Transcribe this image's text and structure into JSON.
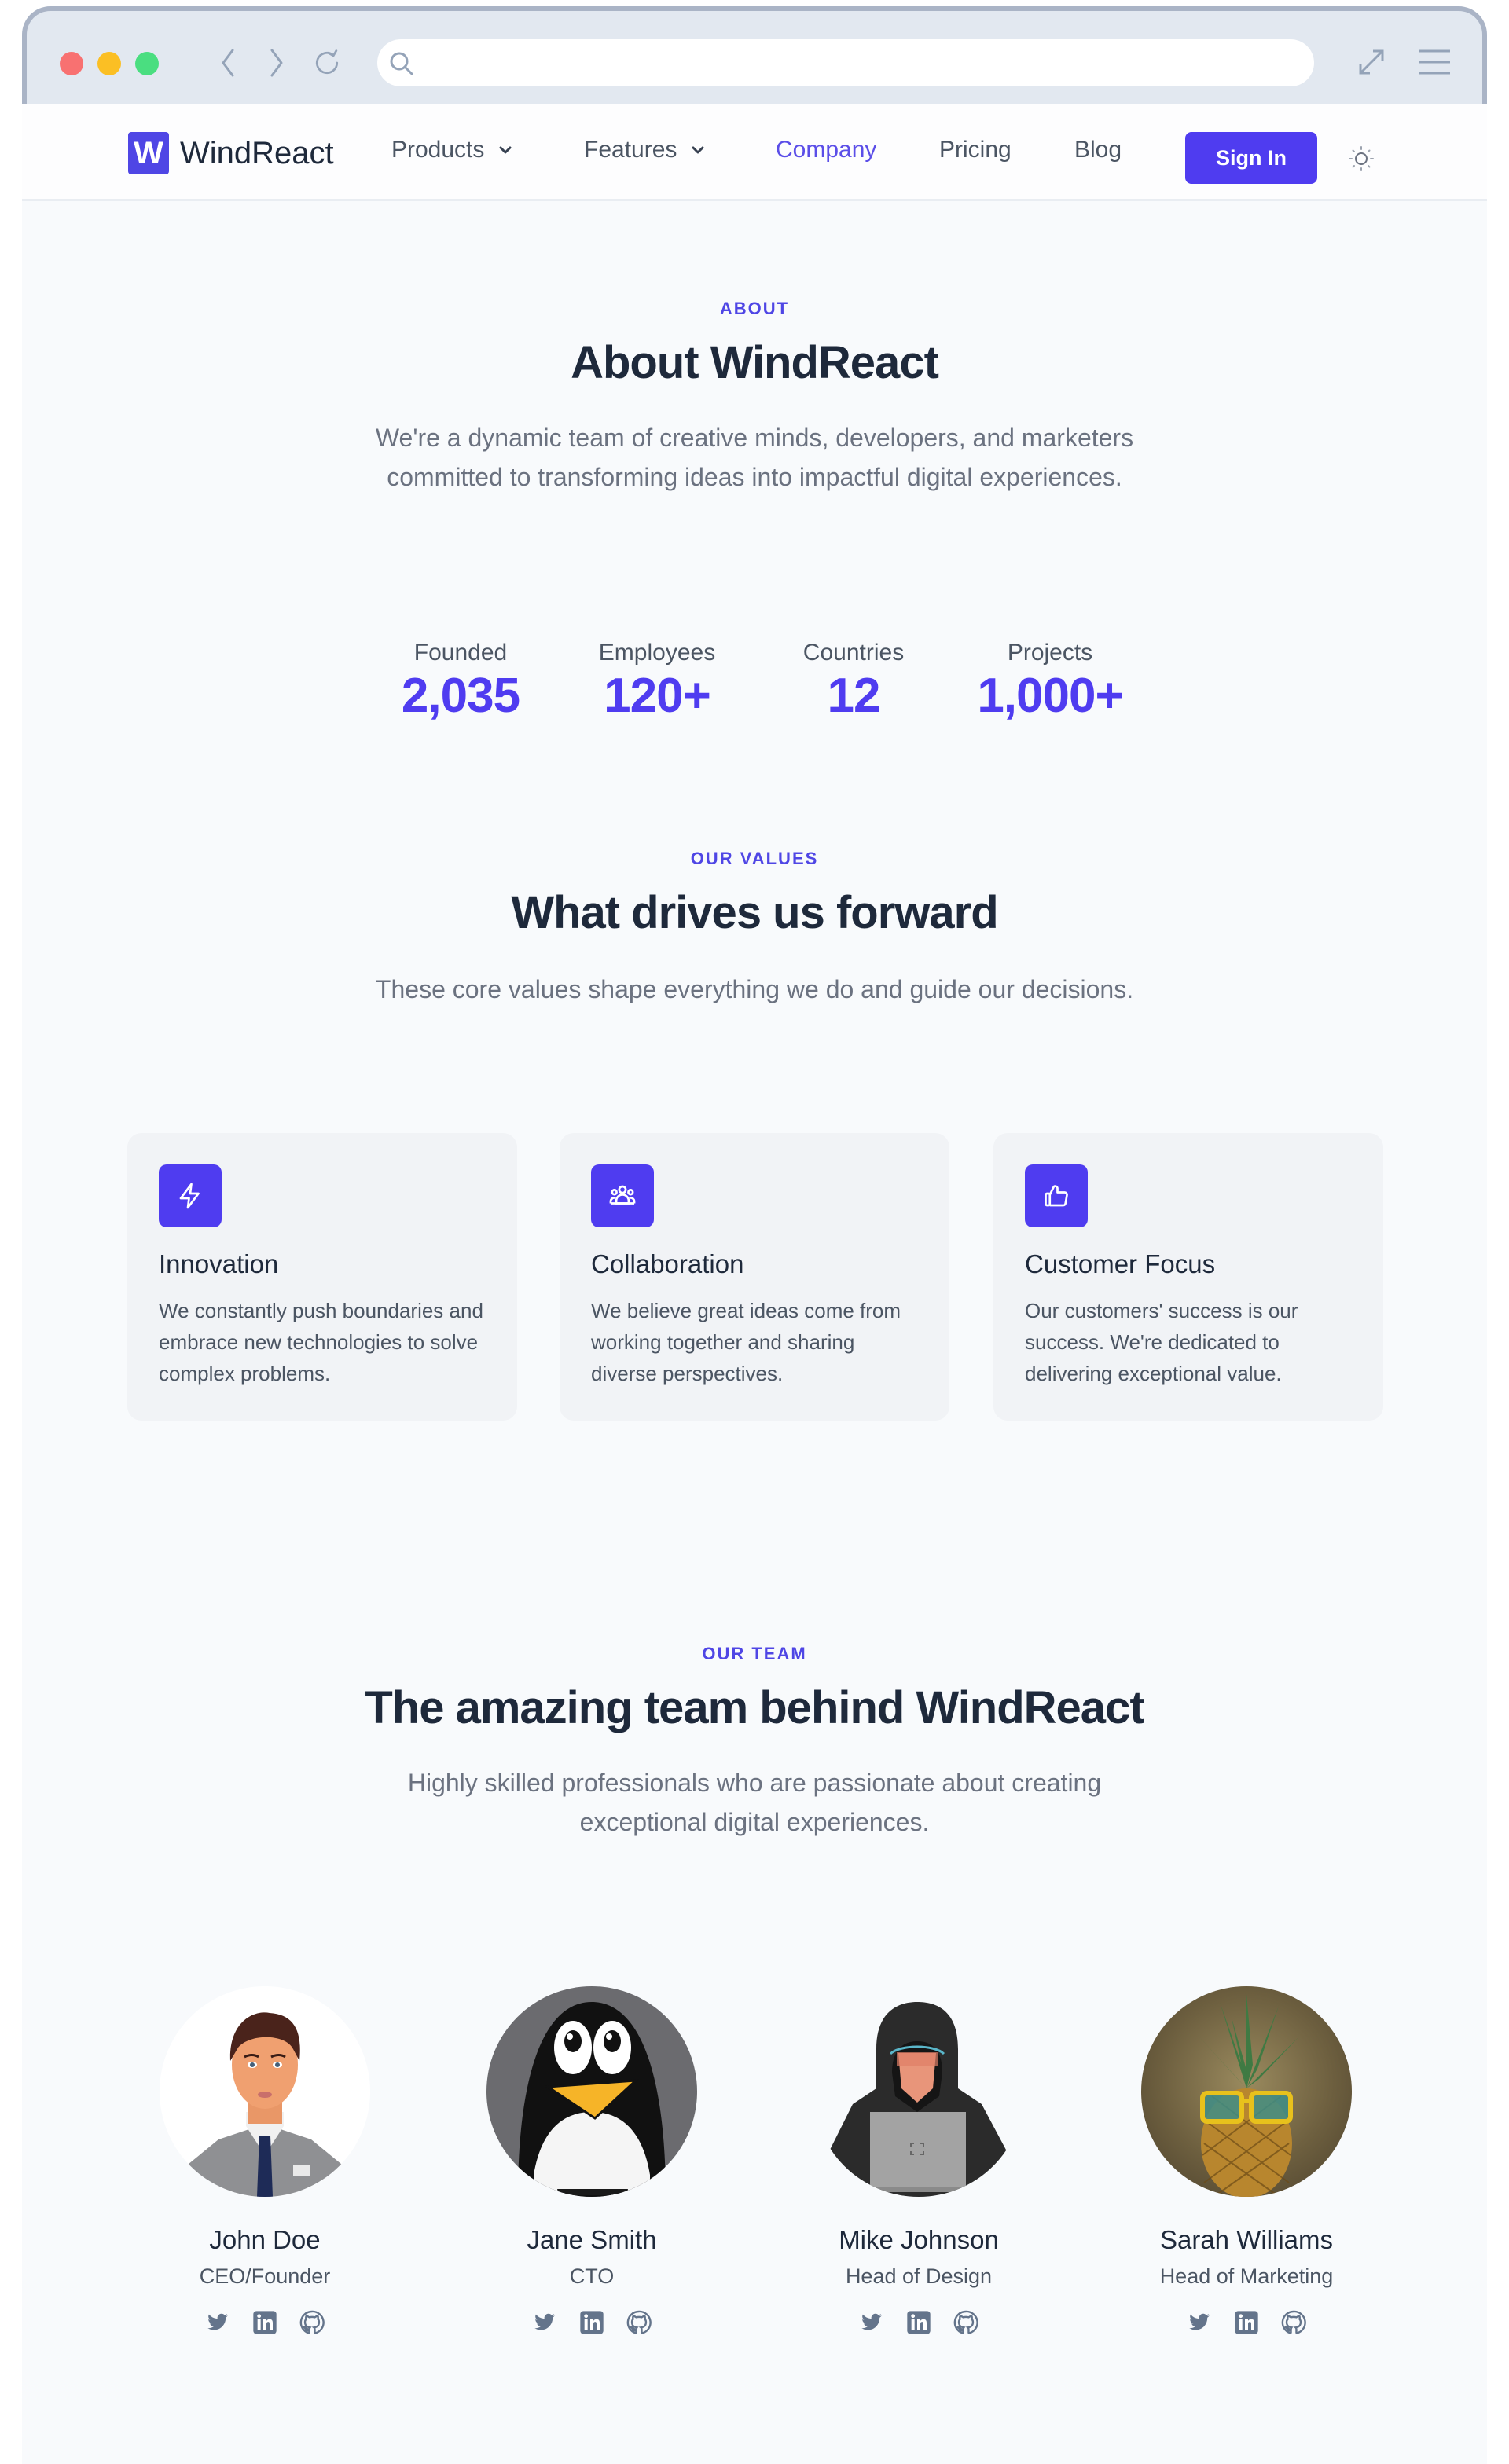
{
  "browser": {
    "url_value": "",
    "url_placeholder": ""
  },
  "nav": {
    "logo_mark": "W",
    "logo_text": "WindReact",
    "links": [
      {
        "label": "Products",
        "has_dropdown": true,
        "active": false
      },
      {
        "label": "Features",
        "has_dropdown": true,
        "active": false
      },
      {
        "label": "Company",
        "has_dropdown": false,
        "active": true
      },
      {
        "label": "Pricing",
        "has_dropdown": false,
        "active": false
      },
      {
        "label": "Blog",
        "has_dropdown": false,
        "active": false
      }
    ],
    "signin_label": "Sign In",
    "theme_icon": "sun-icon"
  },
  "about": {
    "eyebrow": "ABOUT",
    "title": "About WindReact",
    "description": "We're a dynamic team of creative minds, developers, and marketers committed to transforming ideas into impactful digital experiences."
  },
  "stats": [
    {
      "label": "Founded",
      "value": "2,035"
    },
    {
      "label": "Employees",
      "value": "120+"
    },
    {
      "label": "Countries",
      "value": "12"
    },
    {
      "label": "Projects",
      "value": "1,000+"
    }
  ],
  "values": {
    "eyebrow": "OUR VALUES",
    "title": "What drives us forward",
    "description": "These core values shape everything we do and guide our decisions.",
    "cards": [
      {
        "icon": "lightning-icon",
        "title": "Innovation",
        "description": "We constantly push boundaries and embrace new technologies to solve complex problems."
      },
      {
        "icon": "users-group-icon",
        "title": "Collaboration",
        "description": "We believe great ideas come from working together and sharing diverse perspectives."
      },
      {
        "icon": "thumbs-up-icon",
        "title": "Customer Focus",
        "description": "Our customers' success is our success. We're dedicated to delivering exceptional value."
      }
    ]
  },
  "team": {
    "eyebrow": "OUR TEAM",
    "title": "The amazing team behind WindReact",
    "description": "Highly skilled professionals who are passionate about creating exceptional digital experiences.",
    "members": [
      {
        "name": "John Doe",
        "role": "CEO/Founder",
        "avatar": "businessman-avatar"
      },
      {
        "name": "Jane Smith",
        "role": "CTO",
        "avatar": "penguin-avatar"
      },
      {
        "name": "Mike Johnson",
        "role": "Head of Design",
        "avatar": "hooded-hacker-avatar"
      },
      {
        "name": "Sarah Williams",
        "role": "Head of Marketing",
        "avatar": "pineapple-sunglasses-avatar"
      }
    ],
    "social_icons": [
      "twitter-icon",
      "linkedin-icon",
      "github-icon"
    ]
  },
  "colors": {
    "accent": "#4f3cf0",
    "page_bg": "#f8fafc",
    "card_bg": "#f1f3f6",
    "heading": "#1e293b",
    "body_text": "#6b7280"
  }
}
